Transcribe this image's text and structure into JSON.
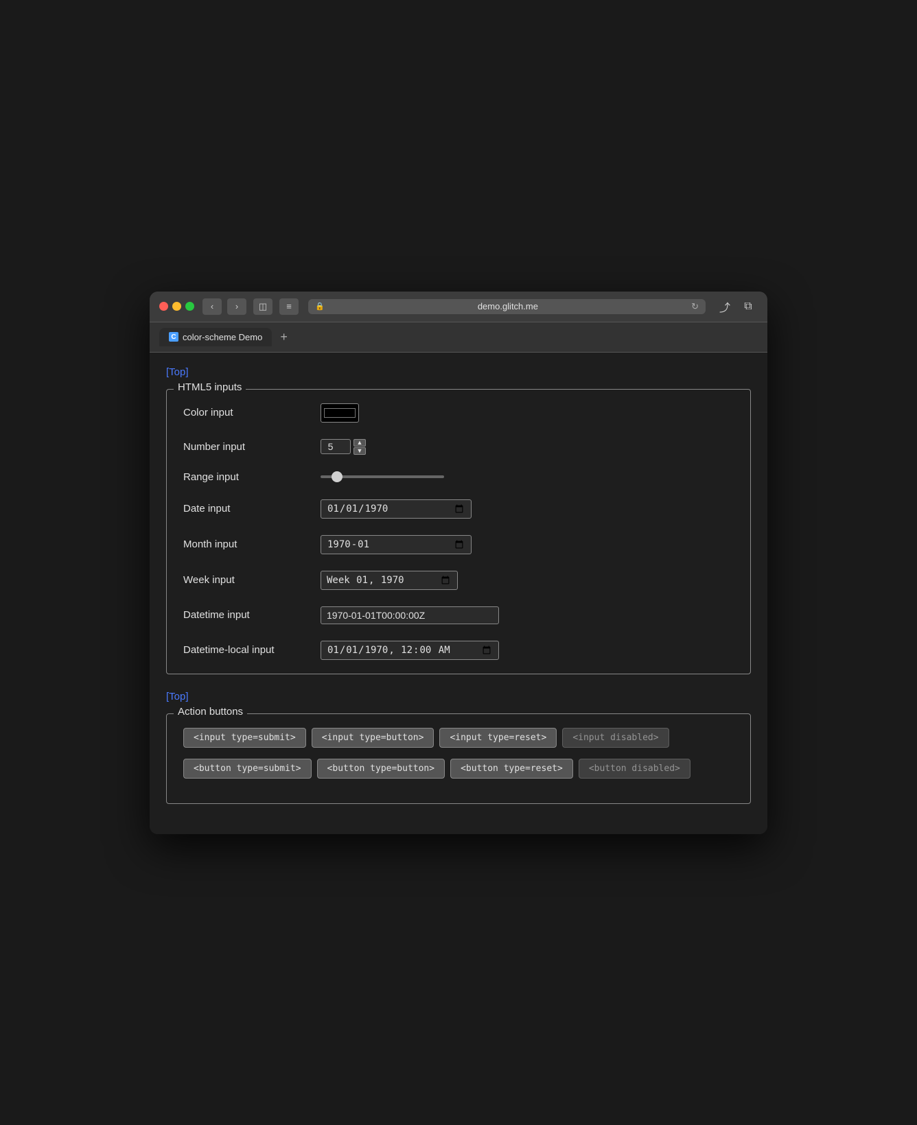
{
  "browser": {
    "url": "demo.glitch.me",
    "tab_title": "color-scheme Demo",
    "tab_favicon": "C",
    "back_btn": "‹",
    "forward_btn": "›",
    "sidebar_icon": "⊞",
    "menu_icon": "≡",
    "lock_icon": "🔒",
    "refresh_icon": "↻",
    "share_icon": "⬆",
    "tabs_icon": "⧉",
    "add_tab": "+"
  },
  "page": {
    "top_link_1": "[Top]",
    "top_link_2": "[Top]"
  },
  "html5_inputs": {
    "legend": "HTML5 inputs",
    "color_label": "Color input",
    "color_value": "#000000",
    "number_label": "Number input",
    "number_value": "5",
    "range_label": "Range input",
    "range_value": "10",
    "date_label": "Date input",
    "date_value": "1970-01-01",
    "month_label": "Month input",
    "month_value": "1970-01",
    "week_label": "Week input",
    "week_value": "1970-W01",
    "datetime_label": "Datetime input",
    "datetime_value": "1970-01-01T00:00:00Z",
    "datetime_local_label": "Datetime-local input",
    "datetime_local_value": "1970-01-01T00:00"
  },
  "action_buttons": {
    "legend": "Action buttons",
    "input_submit": "<input type=submit>",
    "input_button": "<input type=button>",
    "input_reset": "<input type=reset>",
    "input_disabled": "<input disabled>",
    "button_submit": "<button type=submit>",
    "button_button": "<button type=button>",
    "button_reset": "<button type=reset>",
    "button_disabled": "<button disabled>"
  }
}
